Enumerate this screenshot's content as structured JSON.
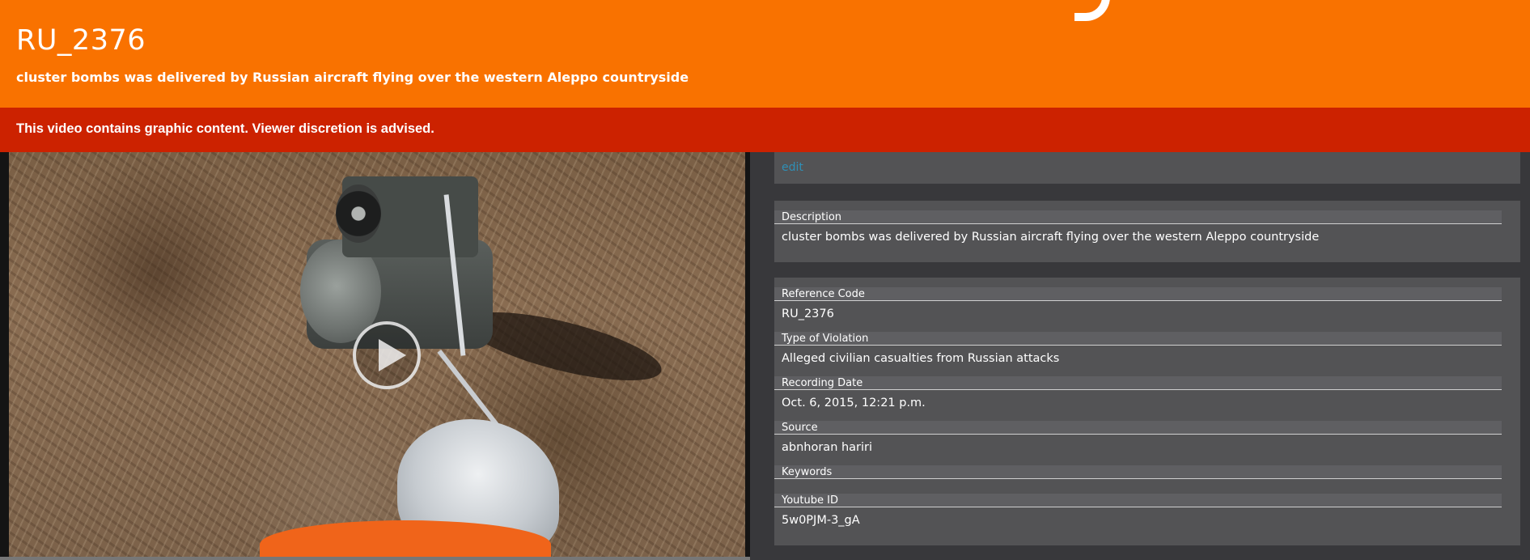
{
  "header": {
    "title": "RU_2376",
    "subtitle": "cluster bombs was delivered by Russian aircraft flying over the western Aleppo countryside",
    "background_color": "#f97200"
  },
  "warning": {
    "text": "This video contains graphic content. Viewer discretion is advised.",
    "background_color": "#cc2200"
  },
  "video": {
    "play_icon": "play-circle-icon"
  },
  "panel": {
    "edit_label": "edit",
    "description": {
      "label": "Description",
      "value": "cluster bombs was delivered by Russian aircraft flying over the western Aleppo countryside"
    },
    "fields": [
      {
        "label": "Reference Code",
        "value": "RU_2376"
      },
      {
        "label": "Type of Violation",
        "value": "Alleged civilian casualties from Russian attacks"
      },
      {
        "label": "Recording Date",
        "value": "Oct. 6, 2015, 12:21 p.m."
      },
      {
        "label": "Source",
        "value": "abnhoran hariri"
      },
      {
        "label": "Keywords",
        "value": ""
      },
      {
        "label": "Youtube ID",
        "value": "5w0PJM-3_gA"
      }
    ],
    "link_color": "#2f8fb5"
  }
}
